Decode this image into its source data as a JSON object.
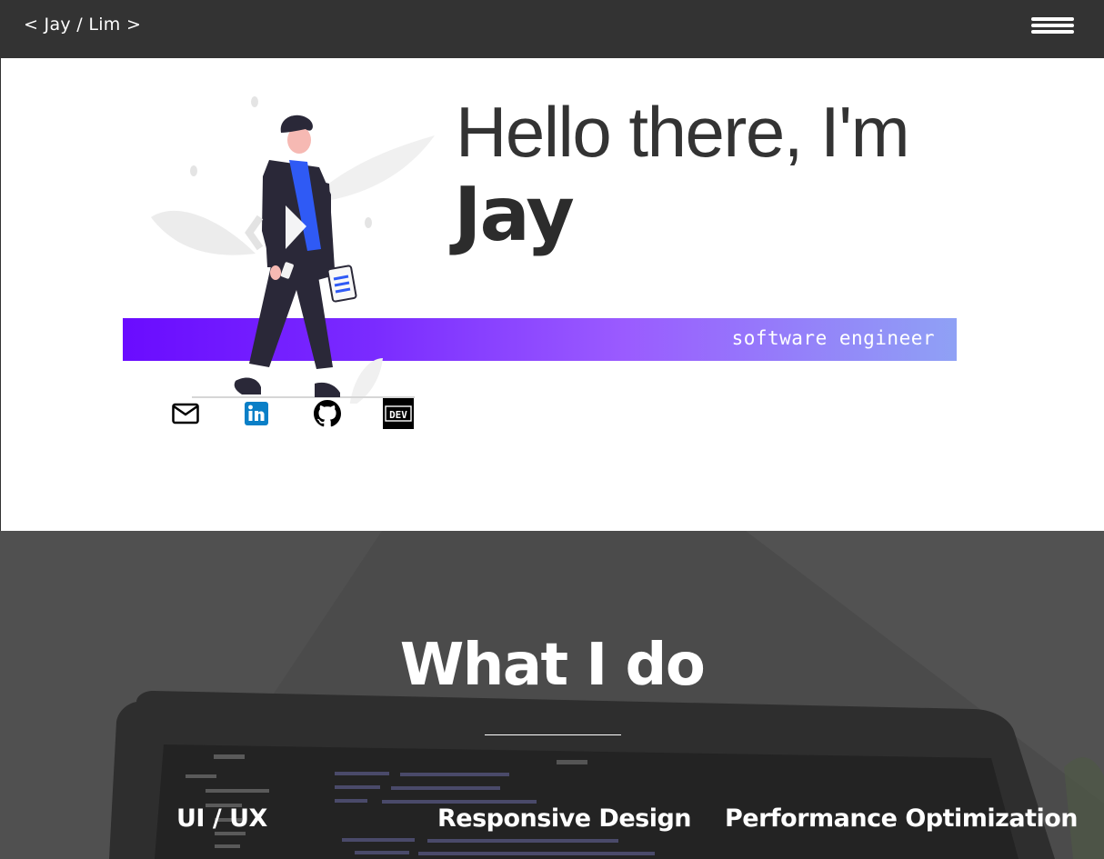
{
  "navbar": {
    "brand": "< Jay / Lim >",
    "menu_icon": "hamburger-menu-icon"
  },
  "hero": {
    "greeting": "Hello there, I'm",
    "name": "Jay",
    "role": "software engineer",
    "illustration": "person-standing-illustration",
    "social": [
      {
        "icon": "email-icon"
      },
      {
        "icon": "linkedin-icon"
      },
      {
        "icon": "github-icon"
      },
      {
        "icon": "dev-to-icon",
        "label": "DEV"
      }
    ]
  },
  "what_i_do": {
    "title": "What I do",
    "services": [
      "UI / UX",
      "Responsive Design",
      "Performance Optimization"
    ]
  },
  "colors": {
    "navbar_bg": "#333333",
    "accent_gradient_start": "#6a0cff",
    "accent_gradient_end": "#8fa1f5",
    "figure_blue": "#2f5af5",
    "linkedin_blue": "#0a7fc7"
  }
}
